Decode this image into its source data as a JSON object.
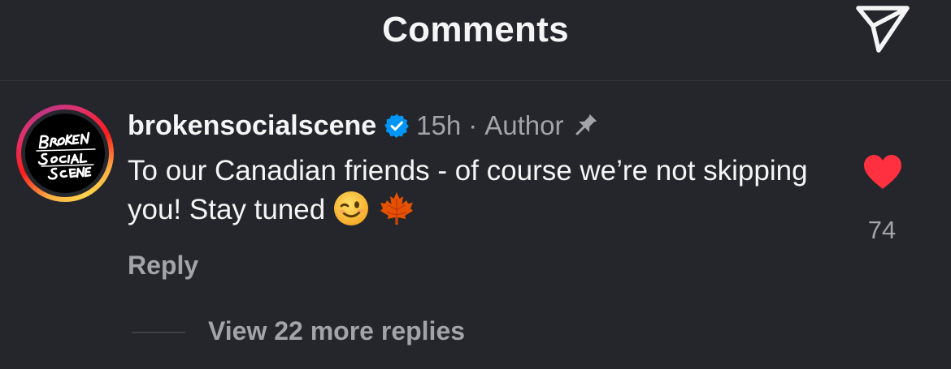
{
  "header": {
    "title": "Comments",
    "share_icon": "send-icon"
  },
  "comment": {
    "avatar": {
      "logo_text": "Broken Social Scene",
      "ring_colors": [
        "#fcb045",
        "#fd1d1d",
        "#e1306c",
        "#c13584"
      ]
    },
    "username": "brokensocialscene",
    "verified": true,
    "time": "15h",
    "separator": "·",
    "author_label": "Author",
    "pinned": true,
    "text": "To our Canadian friends - of course we’re not skipping you! Stay tuned",
    "emojis": [
      "winking-face",
      "maple-leaf"
    ],
    "reply_label": "Reply",
    "liked": true,
    "like_count": "74",
    "view_replies_label": "View 22 more replies"
  },
  "colors": {
    "background": "#25262b",
    "text_primary": "#f5f5f5",
    "text_secondary": "#a2a4a9",
    "verified_blue": "#0095f6",
    "like_red": "#ff3040"
  }
}
